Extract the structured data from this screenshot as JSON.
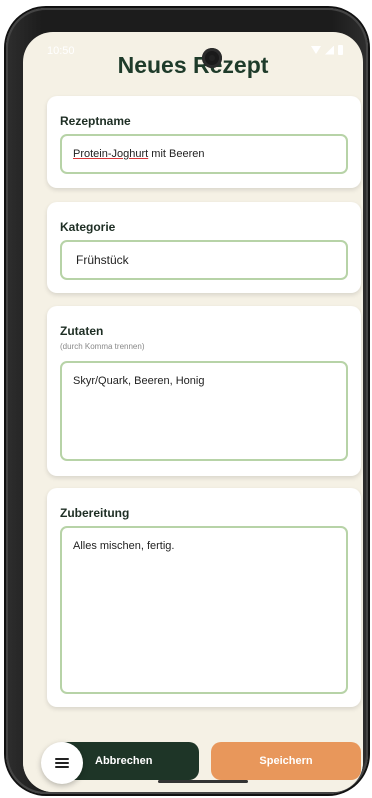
{
  "status_bar": {
    "time": "10:50",
    "icons": [
      "wifi-icon",
      "signal-icon",
      "battery-icon"
    ]
  },
  "app": {
    "title": "Neues Rezept"
  },
  "form": {
    "name": {
      "label": "Rezeptname",
      "value_first_word": "Protein-Joghurt",
      "value_rest": " mit Beeren"
    },
    "category": {
      "label": "Kategorie",
      "value": "Frühstück"
    },
    "ingredients": {
      "label": "Zutaten",
      "hint": "(durch Komma trennen)",
      "value": "Skyr/Quark, Beeren, Honig"
    },
    "preparation": {
      "label": "Zubereitung",
      "value": "Alles mischen, fertig."
    }
  },
  "actions": {
    "cancel_label": "Abbrechen",
    "save_label": "Speichern",
    "menu_icon": "menu-icon"
  },
  "colors": {
    "background": "#f5f1e5",
    "title": "#1e3b2a",
    "field_border": "#b7d3a7",
    "cancel_button": "#1e3527",
    "save_button": "#e8975b"
  }
}
